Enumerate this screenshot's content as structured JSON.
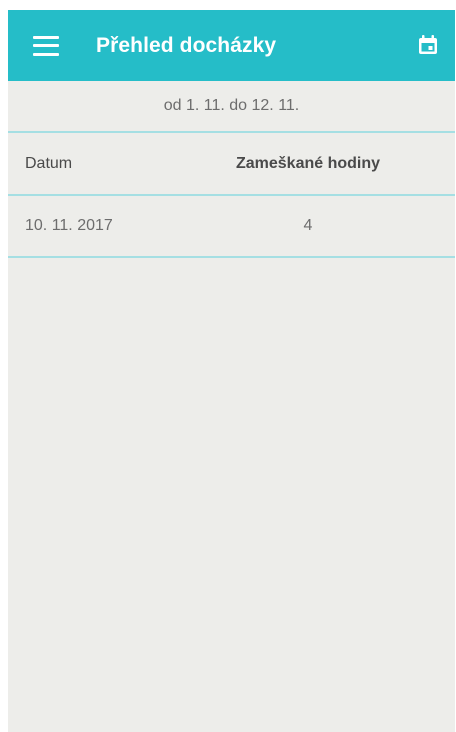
{
  "app_bar": {
    "title": "Přehled docházky",
    "menu_icon": "menu-icon",
    "calendar_icon": "calendar-icon",
    "color": "#25bdc8"
  },
  "range": {
    "text": "od 1. 11. do 12. 11."
  },
  "table": {
    "columns": [
      "Datum",
      "Zameškané hodiny"
    ],
    "rows": [
      {
        "date": "10. 11. 2017",
        "hours": "4"
      }
    ]
  }
}
